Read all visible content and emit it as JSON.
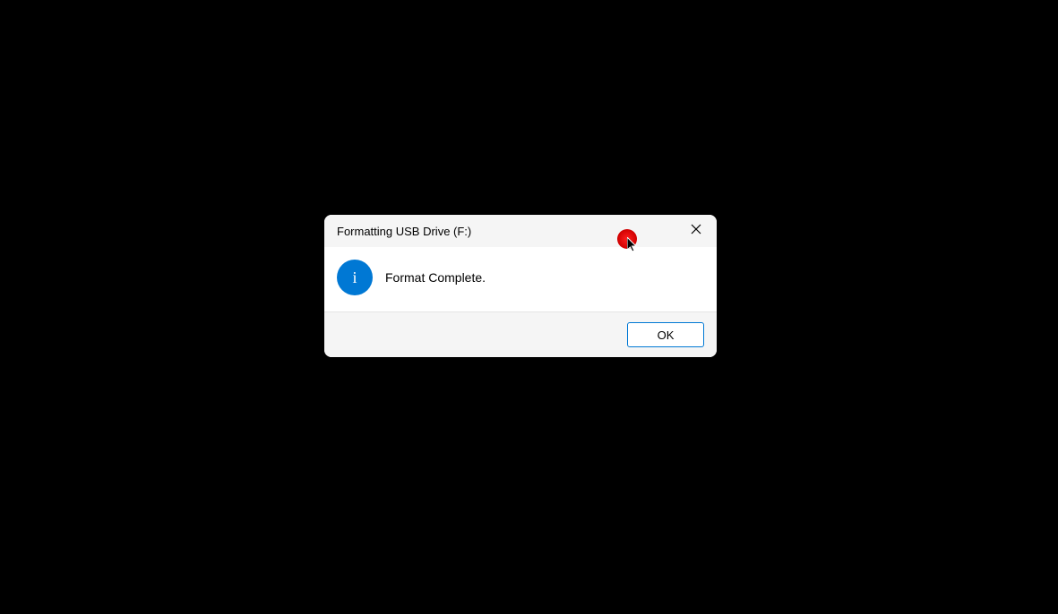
{
  "dialog": {
    "title": "Formatting USB Drive (F:)",
    "message": "Format Complete.",
    "ok_label": "OK",
    "info_glyph": "i"
  }
}
